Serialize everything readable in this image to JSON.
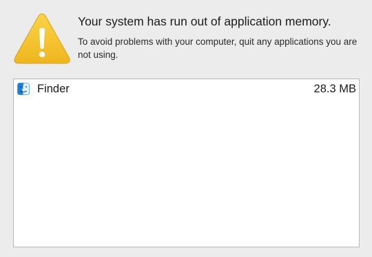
{
  "alert": {
    "icon": "warning-triangle-icon",
    "title": "Your system has run out of application memory.",
    "message": "To avoid problems with your computer, quit any applications you are not using."
  },
  "apps": [
    {
      "icon": "finder-icon",
      "name": "Finder",
      "memory": "28.3 MB"
    }
  ],
  "colors": {
    "background": "#ececec",
    "warning_yellow": "#f4c532",
    "list_background": "#ffffff"
  }
}
